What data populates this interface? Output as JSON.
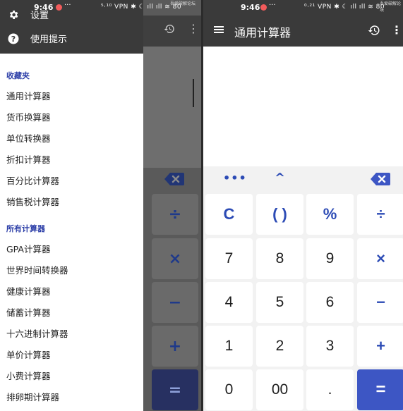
{
  "left": {
    "status": {
      "time": "9:46",
      "dots": "···",
      "indicators": "⁵·¹⁰ VPN ✱ ☾ ıll ıll ≋ 80",
      "tiny": "吾爱破解论坛"
    },
    "drawer": {
      "header_items": [
        {
          "label": "设置",
          "icon": "gear-icon"
        },
        {
          "label": "使用提示",
          "icon": "help-circle-icon"
        }
      ],
      "favorites_title": "收藏夹",
      "favorites": [
        "通用计算器",
        "货币换算器",
        "单位转换器",
        "折扣计算器",
        "百分比计算器",
        "销售税计算器"
      ],
      "all_title": "所有计算器",
      "all": [
        "GPA计算器",
        "世界时间转换器",
        "健康计算器",
        "储蓄计算器",
        "十六进制计算器",
        "单价计算器",
        "小费计算器",
        "排卵期计算器"
      ]
    },
    "keys": [
      "÷",
      "×",
      "−",
      "+",
      "="
    ]
  },
  "right": {
    "status": {
      "time": "9:46",
      "dots": "···",
      "indicators": "⁰·²¹ VPN ✱ ☾ ıll ıll ≋ 80",
      "tiny": "吾爱破解论坛"
    },
    "appbar": {
      "title": "通用计算器"
    },
    "strip": {
      "more": "•••",
      "expand": "^"
    },
    "keys": [
      {
        "label": "C",
        "type": "fn"
      },
      {
        "label": "( )",
        "type": "fn"
      },
      {
        "label": "%",
        "type": "fn"
      },
      {
        "label": "÷",
        "type": "fn"
      },
      {
        "label": "7",
        "type": "num"
      },
      {
        "label": "8",
        "type": "num"
      },
      {
        "label": "9",
        "type": "num"
      },
      {
        "label": "×",
        "type": "fn"
      },
      {
        "label": "4",
        "type": "num"
      },
      {
        "label": "5",
        "type": "num"
      },
      {
        "label": "6",
        "type": "num"
      },
      {
        "label": "−",
        "type": "fn"
      },
      {
        "label": "1",
        "type": "num"
      },
      {
        "label": "2",
        "type": "num"
      },
      {
        "label": "3",
        "type": "num"
      },
      {
        "label": "+",
        "type": "fn"
      },
      {
        "label": "0",
        "type": "num"
      },
      {
        "label": "00",
        "type": "num"
      },
      {
        "label": ".",
        "type": "num"
      },
      {
        "label": "=",
        "type": "eq"
      }
    ]
  },
  "colors": {
    "accent": "#3d56c4",
    "fn_text": "#2c4bb5",
    "appbar": "#3a3a3a",
    "backspace": "#3d56c4"
  }
}
